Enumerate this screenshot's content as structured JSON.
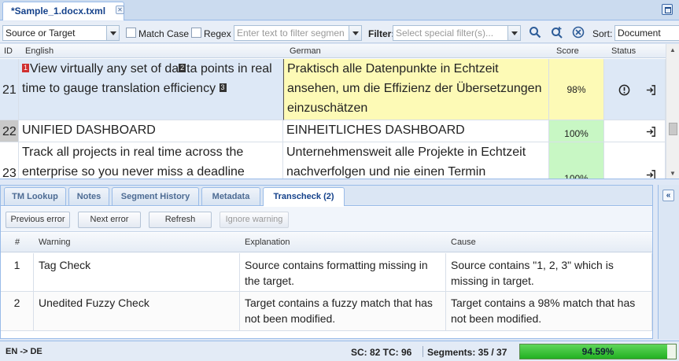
{
  "document_tab": {
    "title": "*Sample_1.docx.txml"
  },
  "toolbar": {
    "search_scope": "Source or Target",
    "match_case_label": "Match Case",
    "regex_label": "Regex",
    "filter_text_placeholder": "Enter text to filter segmen",
    "filter_label": "Filter:",
    "special_filter_placeholder": "Select special filter(s)...",
    "sort_label": "Sort:",
    "sort_value": "Document"
  },
  "grid": {
    "headers": {
      "id": "ID",
      "source": "English",
      "target": "German",
      "score": "Score",
      "status": "Status"
    },
    "rows": [
      {
        "id": "21",
        "source_parts": [
          "View virtually any set of da",
          "ta points in real time to gauge translation efficiency"
        ],
        "tags": [
          "1",
          "2",
          "3"
        ],
        "target": "Praktisch alle Datenpunkte in Echtzeit ansehen, um die Effizienz der Übersetzungen einzuschätzen",
        "score": "98%"
      },
      {
        "id": "22",
        "source": "UNIFIED DASHBOARD",
        "target": "EINHEITLICHES DASHBOARD",
        "score": "100%"
      },
      {
        "id": "23",
        "source": "Track all projects in real time across the enterprise so you never miss a deadline",
        "target": "Unternehmensweit alle Projekte in Echtzeit nachverfolgen und nie einen Termin",
        "score": "100%"
      }
    ]
  },
  "bottom_tabs": [
    "TM Lookup",
    "Notes",
    "Segment History",
    "Metadata",
    "Transcheck (2)"
  ],
  "buttons": {
    "previous_error": "Previous error",
    "next_error": "Next error",
    "refresh": "Refresh",
    "ignore_warning": "Ignore warning"
  },
  "warnings": {
    "headers": {
      "num": "#",
      "warning": "Warning",
      "explanation": "Explanation",
      "cause": "Cause"
    },
    "rows": [
      {
        "num": "1",
        "warning": "Tag Check",
        "explanation": "Source contains formatting missing in the target.",
        "cause": "Source contains \"1, 2, 3\" which is missing in target."
      },
      {
        "num": "2",
        "warning": "Unedited Fuzzy Check",
        "explanation": "Target contains a fuzzy match that has not been modified.",
        "cause": "Target contains a 98% match that has not been modified."
      }
    ]
  },
  "statusbar": {
    "language_pair": "EN -> DE",
    "sc_tc": "SC: 82 TC: 96",
    "segments": "Segments: 35 / 37",
    "progress_text": "94.59%",
    "progress_fraction": 0.9459
  },
  "colors": {
    "target_row21_bg": "#fdfab6",
    "score_fuzzy_bg": "#fdfab6",
    "score_exact_bg": "#c8f7c4",
    "selected_row_bg": "#dde8f6",
    "tag_red": "#d03030"
  }
}
